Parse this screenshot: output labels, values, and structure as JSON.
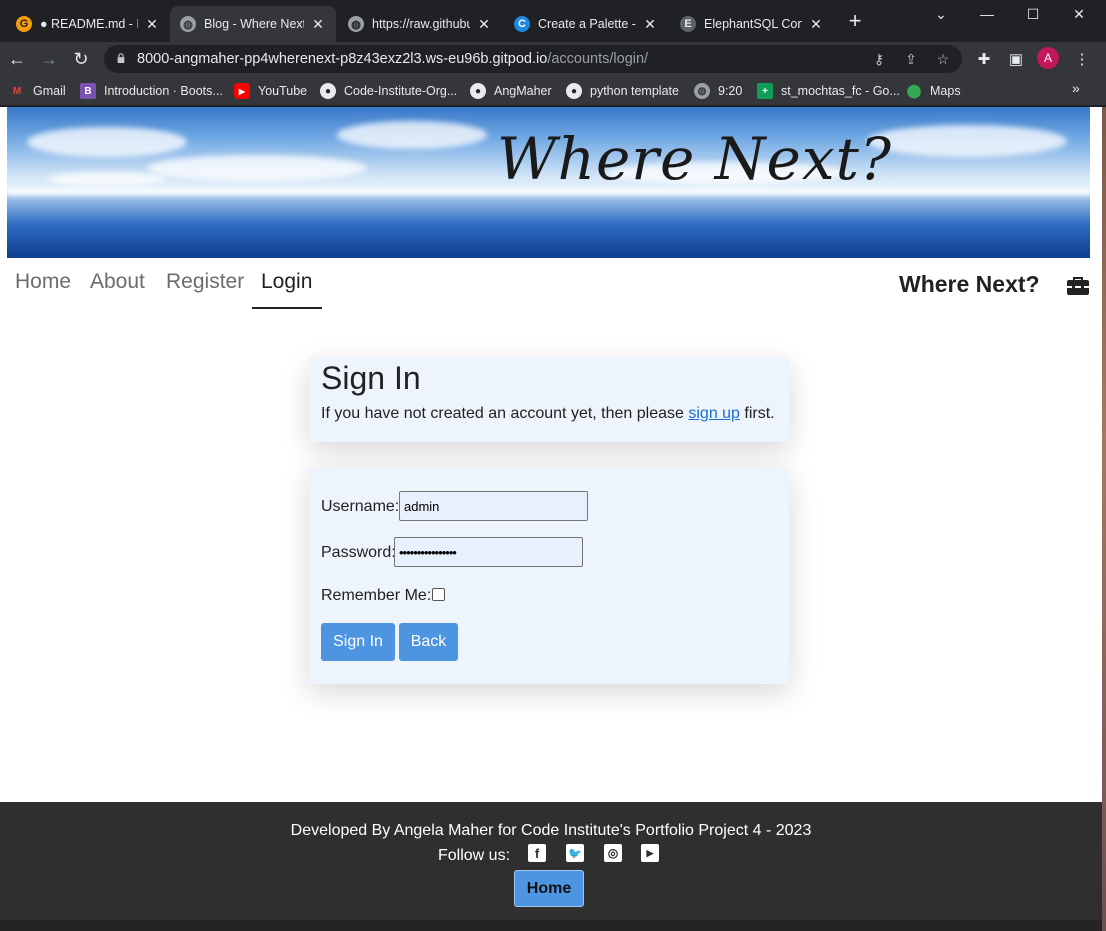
{
  "browser": {
    "tabs": [
      {
        "label": "● README.md - PP",
        "favicon": "gitpod-icon",
        "color": "#f59e0b"
      },
      {
        "label": "Blog - Where Next?",
        "favicon": "globe-icon",
        "color": "#9aa0a6"
      },
      {
        "label": "https://raw.githubu",
        "favicon": "globe-icon",
        "color": "#9aa0a6"
      },
      {
        "label": "Create a Palette - C",
        "favicon": "coolors-icon",
        "color": "#1e88e5"
      },
      {
        "label": "ElephantSQL Conso",
        "favicon": "elephant-icon",
        "color": "#9aa0a6"
      }
    ],
    "url_host": "8000-angmaher-pp4wherenext-p8z43exz2l3.ws-eu96b.gitpod.io",
    "url_path": "/accounts/login/",
    "avatar_letter": "A",
    "bookmarks": [
      {
        "label": "Gmail",
        "icon": "gmail-icon"
      },
      {
        "label": "Introduction · Boots...",
        "icon": "bootstrap-icon"
      },
      {
        "label": "YouTube",
        "icon": "youtube-icon"
      },
      {
        "label": "Code-Institute-Org...",
        "icon": "github-icon"
      },
      {
        "label": "AngMaher",
        "icon": "github-icon"
      },
      {
        "label": "python template",
        "icon": "github-icon"
      },
      {
        "label": "9:20",
        "icon": "globe-icon"
      },
      {
        "label": "st_mochtas_fc - Go...",
        "icon": "sheets-icon"
      },
      {
        "label": "Maps",
        "icon": "maps-icon"
      }
    ]
  },
  "site": {
    "hero_title": "Where Next?",
    "nav": [
      {
        "label": "Home"
      },
      {
        "label": "About"
      },
      {
        "label": "Register"
      },
      {
        "label": "Login"
      }
    ],
    "brand": "Where Next?"
  },
  "signin": {
    "title": "Sign In",
    "text_before": "If you have not created an account yet, then please ",
    "link": "sign up",
    "text_after": " first.",
    "username_label": "Username:",
    "username_value": "admin",
    "password_label": "Password:",
    "password_value": "••••••••••••••••",
    "remember_label": "Remember Me:",
    "signin_button": "Sign In",
    "back_button": "Back"
  },
  "footer": {
    "credit": "Developed By Angela Maher for Code Institute's Portfolio Project 4 - 2023",
    "follow": "Follow us:",
    "home_button": "Home"
  }
}
